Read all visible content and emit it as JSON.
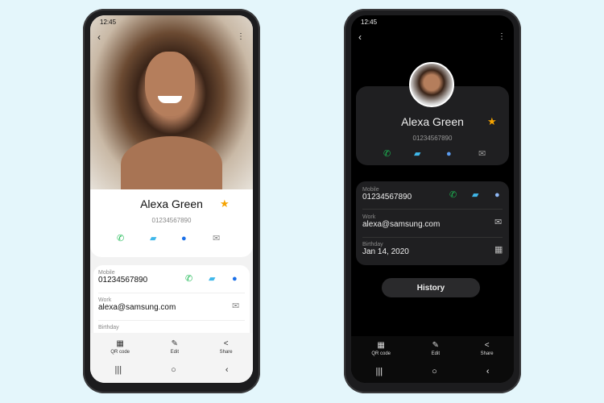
{
  "status": {
    "time": "12:45"
  },
  "contact": {
    "name": "Alexa Green",
    "number": "01234567890"
  },
  "details": [
    {
      "label": "Mobile",
      "value": "01234567890"
    },
    {
      "label": "Work",
      "value": "alexa@samsung.com"
    },
    {
      "label": "Birthday",
      "value": "Jan 14, 2020"
    }
  ],
  "bottom_bar": {
    "qr": "QR code",
    "edit": "Edit",
    "share": "Share"
  },
  "history_label": "History",
  "icons": {
    "call": "phone-icon",
    "message": "message-icon",
    "video": "video-call-icon",
    "email": "mail-icon",
    "calendar": "calendar-icon",
    "favorite": "star-icon"
  },
  "colors": {
    "call": "#1db954",
    "message": "#3fb7ea",
    "video": "#1a6fe8",
    "star": "#f5a300",
    "background": "#e4f6fb"
  }
}
